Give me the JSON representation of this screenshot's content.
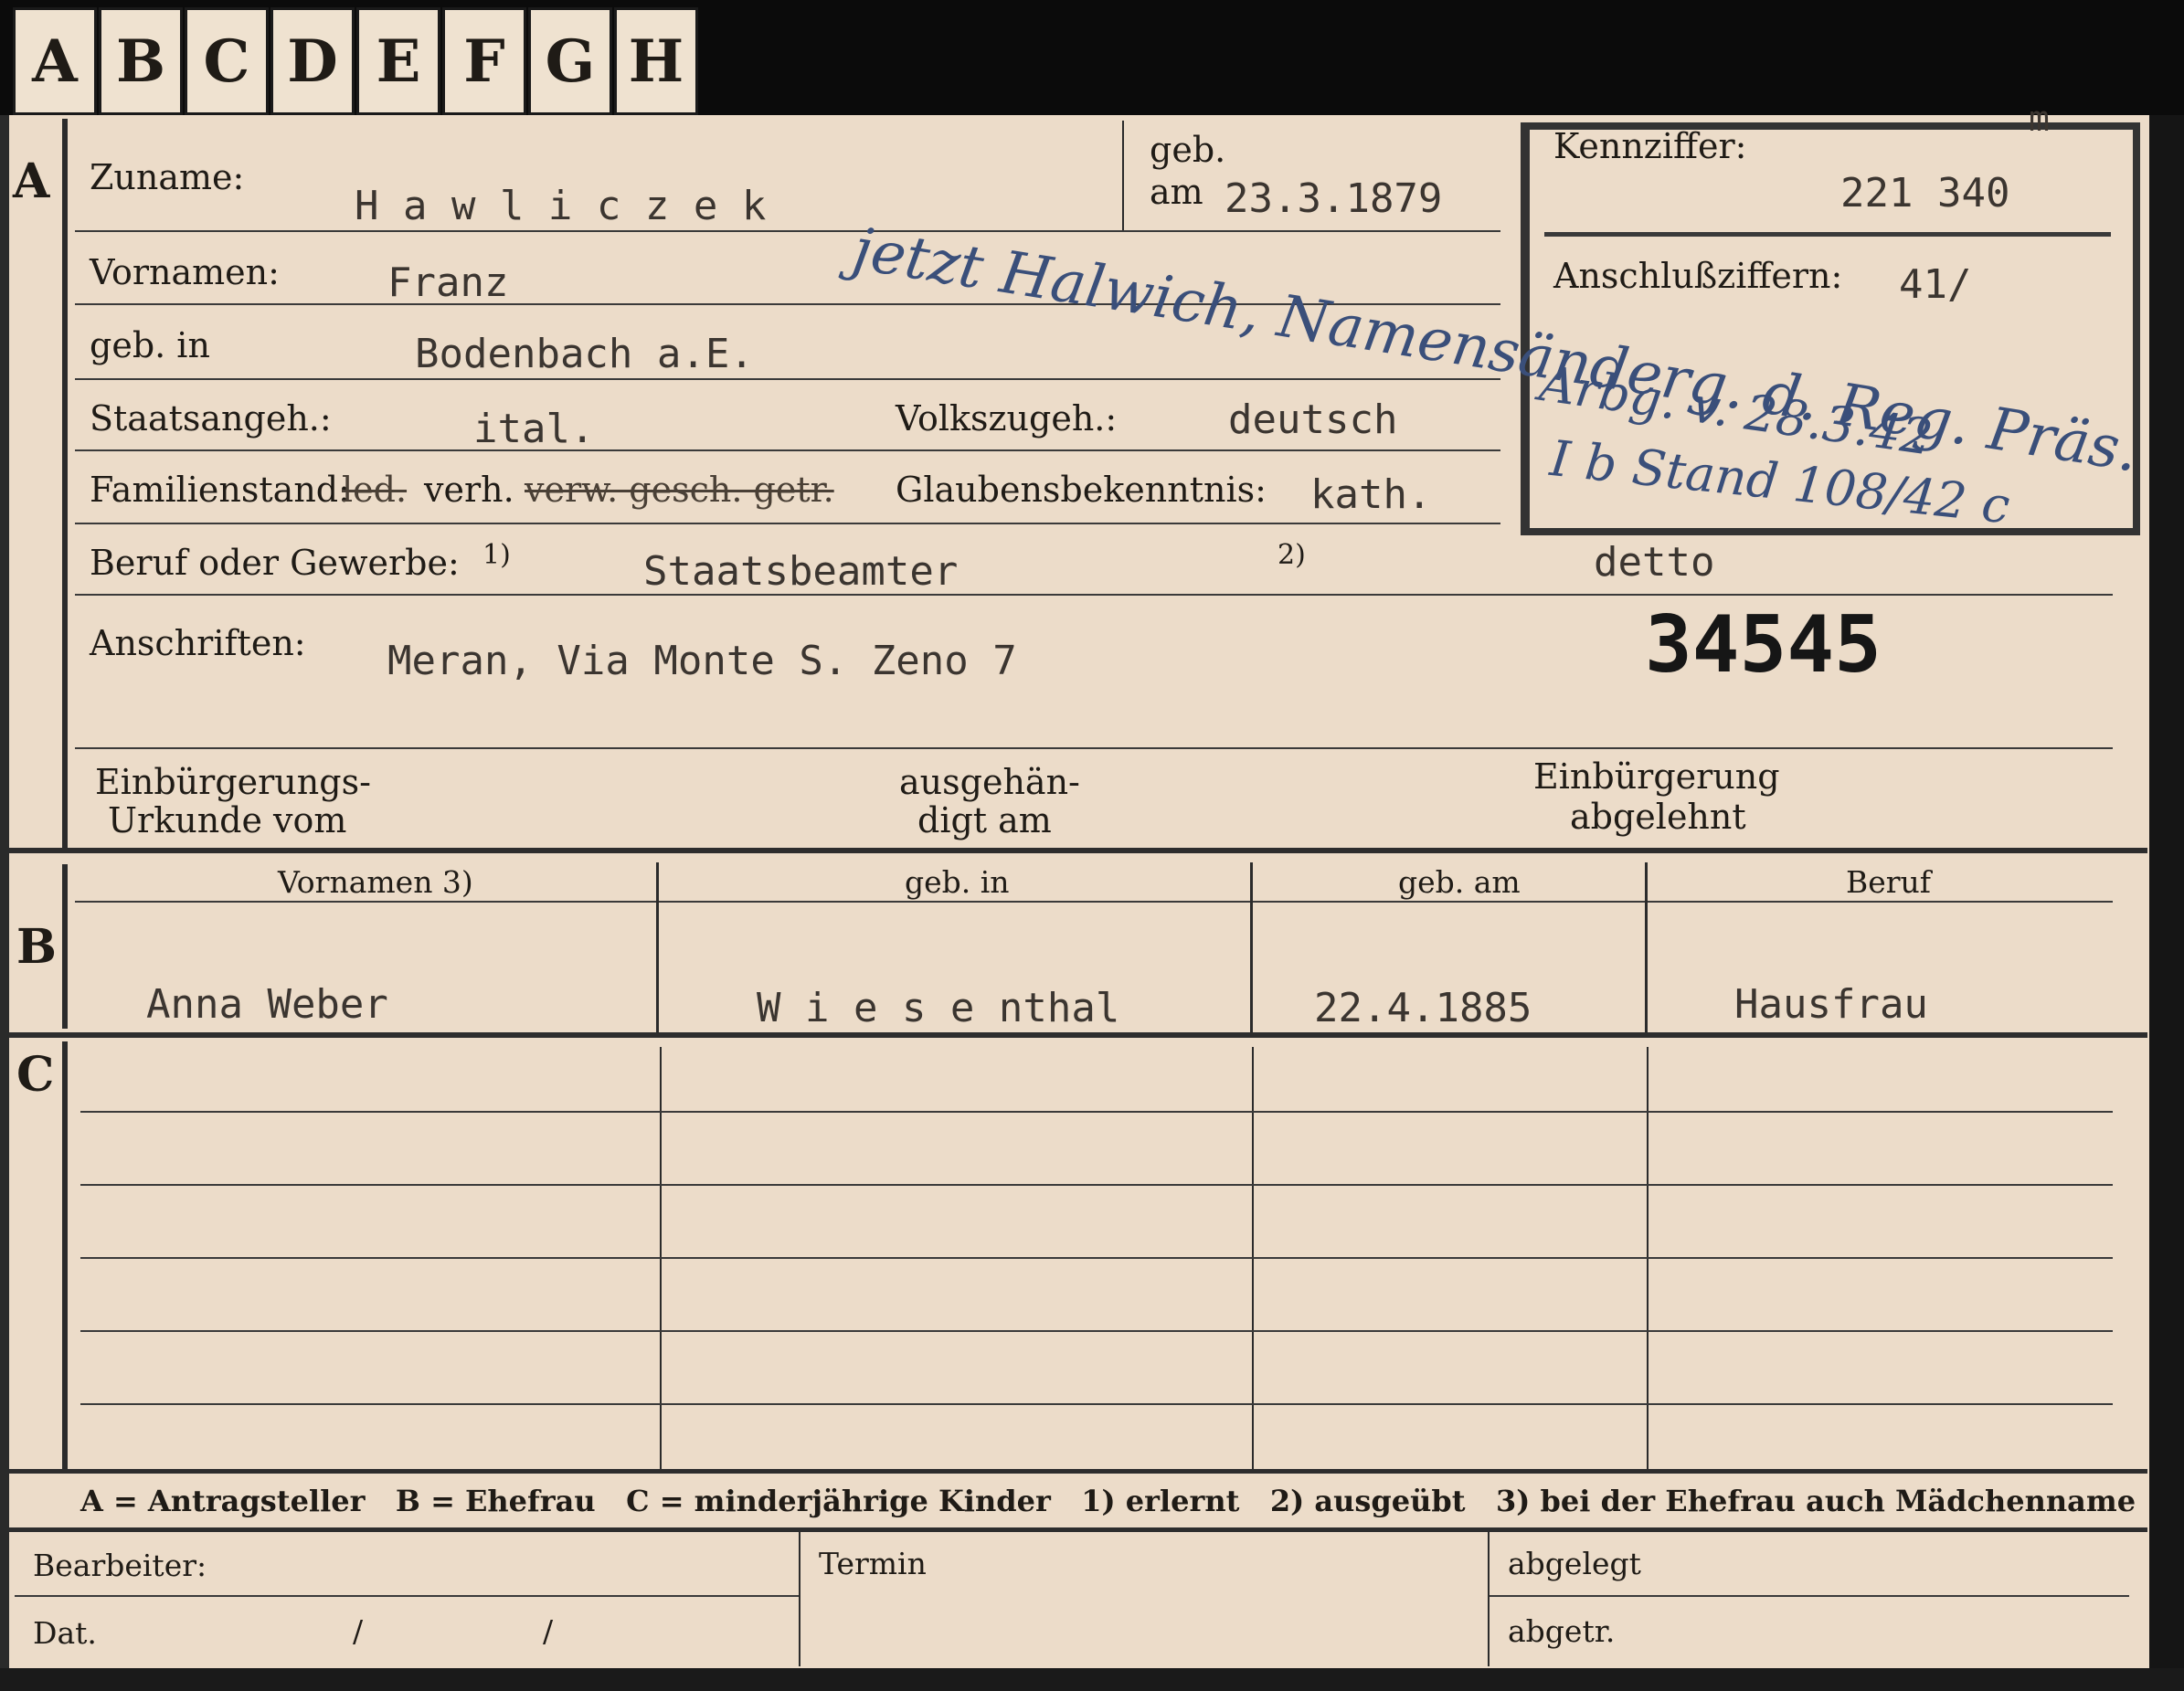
{
  "tabs": [
    "A",
    "B",
    "C",
    "D",
    "E",
    "F",
    "G",
    "H"
  ],
  "section_a": {
    "marker": "A",
    "surname_label": "Zuname:",
    "surname_value": "H a w l i c z e k",
    "born_label_1": "geb.",
    "born_label_2": "am",
    "born_value": "23.3.1879",
    "first_names_label": "Vornamen:",
    "first_names_value": "Franz",
    "birthplace_label": "geb. in",
    "birthplace_value": "Bodenbach a.E.",
    "citizenship_label": "Staatsangeh.:",
    "citizenship_value": "ital.",
    "ethnicity_label": "Volkszugeh.:",
    "ethnicity_value": "deutsch",
    "marital_label": "Familienstand:",
    "marital_struck_1": "led.",
    "marital_value": "verh.",
    "marital_struck_2": "verw. gesch. getr.",
    "religion_label": "Glaubensbekenntnis:",
    "religion_value": "kath.",
    "occupation_label": "Beruf oder Gewerbe:",
    "occupation_note_1": "1)",
    "occupation_value": "Staatsbeamter",
    "occupation_note_2": "2)",
    "occupation_value_2": "detto",
    "address_label": "Anschriften:",
    "address_value": "Meran, Via Monte S. Zeno 7",
    "stamp_number": "34545",
    "naturalization_label_1": "Einbürgerungs-",
    "naturalization_label_2": "Urkunde vom",
    "handed_label_1": "ausgehän-",
    "handed_label_2": "digt am",
    "rejected_label_1": "Einbürgerung",
    "rejected_label_2": "abgelehnt"
  },
  "id_box": {
    "id_label": "Kennziffer:",
    "id_value": "221 340",
    "id_corner": "m",
    "link_label": "Anschlußziffern:",
    "link_value": "41/"
  },
  "handwriting": {
    "line1": "jetzt Halwich, Namensänderg. d. Reg. Präs.",
    "line2": "Arbg. v. 28.3.42",
    "line3": "I b Stand 108/42 c"
  },
  "section_b": {
    "marker": "B",
    "headers": [
      "Vornamen 3)",
      "geb. in",
      "geb. am",
      "Beruf"
    ],
    "row": [
      "Anna Weber",
      "W i e s e nthal",
      "22.4.1885",
      "Hausfrau"
    ]
  },
  "section_c": {
    "marker": "C"
  },
  "legend": "A = Antragsteller   B = Ehefrau   C = minderjährige Kinder   1) erlernt   2) ausgeübt   3) bei der Ehefrau auch Mädchenname",
  "footer": {
    "clerk_label": "Bearbeiter:",
    "date_label": "Dat.",
    "date_slash_1": "/",
    "date_slash_2": "/",
    "deadline_label": "Termin",
    "filed_label": "abgelegt",
    "filed2_label": "abgetr."
  }
}
